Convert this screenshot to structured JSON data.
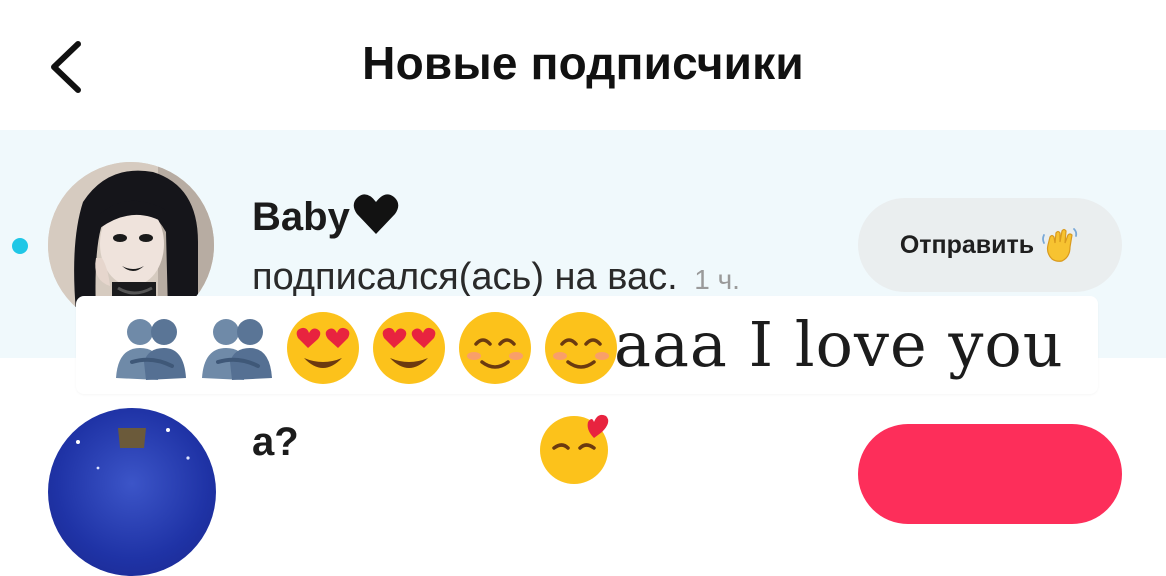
{
  "header": {
    "back_icon": "chevron-left-icon",
    "title": "Новые подписчики"
  },
  "notifications": [
    {
      "username": "Baby",
      "username_emoji": "black-heart",
      "action": "подписался(ась) на вас.",
      "time": "1 ч.",
      "button_label": "Отправить",
      "button_icon": "waving-hand-icon",
      "unread": true
    },
    {
      "username": "а?",
      "button_color": "#fd2e5a"
    }
  ],
  "overlay": {
    "emojis": [
      "people-hugging",
      "people-hugging",
      "heart-eyes",
      "heart-eyes",
      "smiling-face",
      "smiling-face"
    ],
    "text": "aaa I love you"
  },
  "colors": {
    "highlight_row": "#f0f9fc",
    "unread_dot": "#20c7e6",
    "send_button": "#eaeeef",
    "follow_button": "#fd2e5a"
  }
}
